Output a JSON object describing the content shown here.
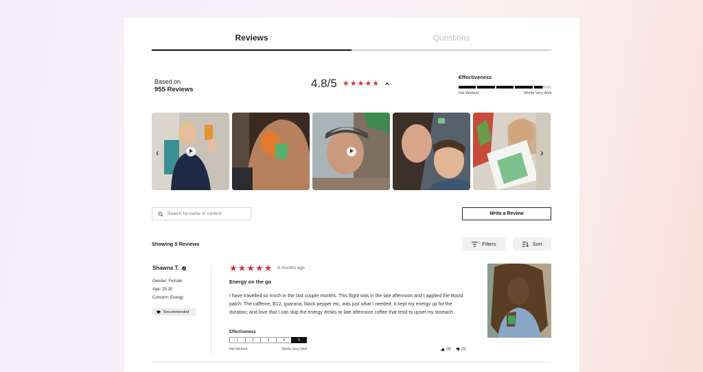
{
  "tabs": [
    {
      "label": "Reviews",
      "active": true
    },
    {
      "label": "Questions",
      "active": false
    }
  ],
  "summary": {
    "based_on": "Based on",
    "review_count": "955 Reviews",
    "rating": "4.8/5",
    "rating_value": 4.8,
    "rating_max": 5
  },
  "effectiveness": {
    "title": "Effectiveness",
    "low_label": "Not Worked",
    "high_label": "Works Very Well",
    "level_fraction": 0.9
  },
  "gallery": {
    "photos": [
      {
        "name": "gallery-photo-1",
        "subject": "selfie with product",
        "has_video": true
      },
      {
        "name": "gallery-photo-2",
        "subject": "patch on arm",
        "has_video": false
      },
      {
        "name": "gallery-photo-3",
        "subject": "man selfie",
        "has_video": true
      },
      {
        "name": "gallery-photo-4",
        "subject": "woman and child",
        "has_video": false
      },
      {
        "name": "gallery-photo-5",
        "subject": "product package",
        "has_video": false
      }
    ],
    "prev_icon": "chevron-left-icon",
    "next_icon": "chevron-right-icon"
  },
  "search": {
    "placeholder": "Search for name or content",
    "value": ""
  },
  "write_review_label": "Write a Review",
  "showing_label": "Showing 5 Reviews",
  "filters_label": "Filters",
  "sort_label": "Sort",
  "reviews": [
    {
      "name": "Shawna T.",
      "gender": "Gender: Female",
      "age": "Age: 25-30",
      "concern": "Concern: Energy",
      "recommended": "Recommended",
      "stars": 5,
      "time": "8 months ago",
      "title": "Energy on the go",
      "body": "I have travelled so much in the last couple months. This flight was in the late afternoon and I applied the Boost patch. The caffeine, B12, guarana, black pepper etc, was just what I needed. It kept my energy up for the duration, and love that I can skip the energy drinks or late afternoon coffee that tend to upset my stomach.",
      "effectiveness_title": "Effectiveness",
      "scale": [
        "1",
        "2",
        "3",
        "4",
        "5"
      ],
      "selected": 5,
      "scale_low": "Not Worked",
      "scale_high": "Works Very Well",
      "helpful": "(8)",
      "unhelpful": "(0)"
    }
  ],
  "colors": {
    "accent_red": "#d6303a",
    "text_dark": "#111111",
    "inactive_tab": "#c4c4c4"
  }
}
